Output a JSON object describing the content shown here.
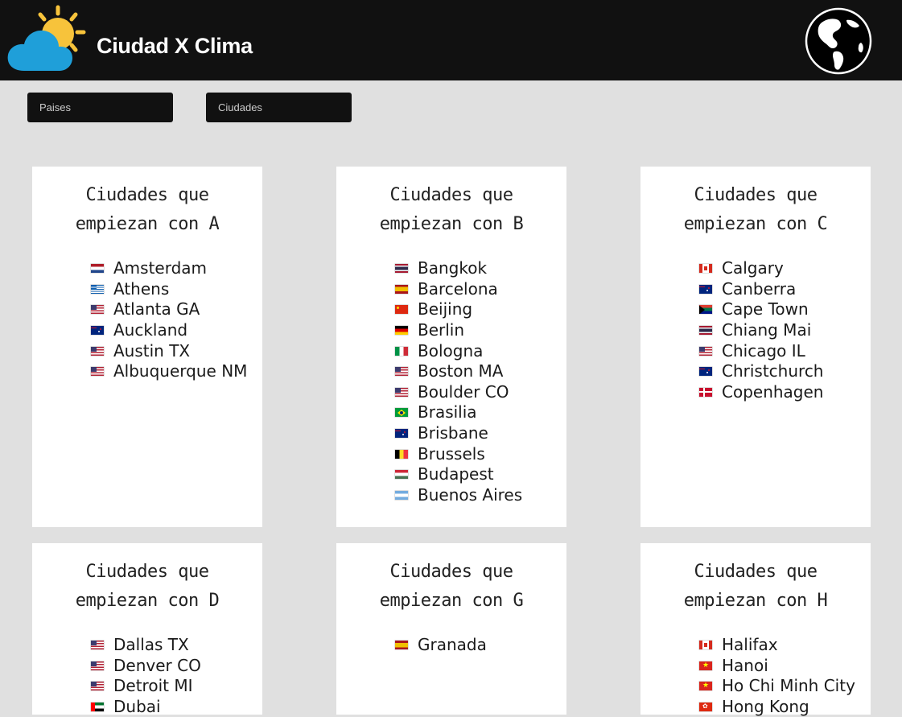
{
  "header": {
    "brand": "Ciudad X Clima",
    "logo_icon": "sun-cloud-icon",
    "globe_icon": "globe-icon"
  },
  "nav": {
    "countries_label": "Paises",
    "cities_label": "Ciudades"
  },
  "colors": {
    "header_bg": "#111111",
    "page_bg": "#e0e0e0",
    "card_bg": "#ffffff",
    "sun": "#f7c33b",
    "cloud": "#1f9fd9"
  },
  "cards": [
    {
      "title": "Ciudades que empiezan con A",
      "cities": [
        {
          "name": "Amsterdam",
          "flag": "nl"
        },
        {
          "name": "Athens",
          "flag": "gr"
        },
        {
          "name": "Atlanta GA",
          "flag": "us"
        },
        {
          "name": "Auckland",
          "flag": "nz"
        },
        {
          "name": "Austin TX",
          "flag": "us"
        },
        {
          "name": "Albuquerque NM",
          "flag": "us"
        }
      ]
    },
    {
      "title": "Ciudades que empiezan con B",
      "cities": [
        {
          "name": "Bangkok",
          "flag": "th"
        },
        {
          "name": "Barcelona",
          "flag": "es"
        },
        {
          "name": "Beijing",
          "flag": "cn"
        },
        {
          "name": "Berlin",
          "flag": "de"
        },
        {
          "name": "Bologna",
          "flag": "it"
        },
        {
          "name": "Boston MA",
          "flag": "us"
        },
        {
          "name": "Boulder CO",
          "flag": "us"
        },
        {
          "name": "Brasilia",
          "flag": "br"
        },
        {
          "name": "Brisbane",
          "flag": "au"
        },
        {
          "name": "Brussels",
          "flag": "be"
        },
        {
          "name": "Budapest",
          "flag": "hu"
        },
        {
          "name": "Buenos Aires",
          "flag": "ar"
        }
      ]
    },
    {
      "title": "Ciudades que empiezan con C",
      "cities": [
        {
          "name": "Calgary",
          "flag": "ca"
        },
        {
          "name": "Canberra",
          "flag": "au"
        },
        {
          "name": "Cape Town",
          "flag": "za"
        },
        {
          "name": "Chiang Mai",
          "flag": "th"
        },
        {
          "name": "Chicago IL",
          "flag": "us"
        },
        {
          "name": "Christchurch",
          "flag": "nz"
        },
        {
          "name": "Copenhagen",
          "flag": "dk"
        }
      ]
    },
    {
      "title": "Ciudades que empiezan con D",
      "cities": [
        {
          "name": "Dallas TX",
          "flag": "us"
        },
        {
          "name": "Denver CO",
          "flag": "us"
        },
        {
          "name": "Detroit MI",
          "flag": "us"
        },
        {
          "name": "Dubai",
          "flag": "ae"
        }
      ]
    },
    {
      "title": "Ciudades que empiezan con G",
      "cities": [
        {
          "name": "Granada",
          "flag": "es"
        }
      ]
    },
    {
      "title": "Ciudades que empiezan con H",
      "cities": [
        {
          "name": "Halifax",
          "flag": "ca"
        },
        {
          "name": "Hanoi",
          "flag": "vn"
        },
        {
          "name": "Ho Chi Minh City",
          "flag": "vn"
        },
        {
          "name": "Hong Kong",
          "flag": "hk"
        }
      ]
    }
  ]
}
